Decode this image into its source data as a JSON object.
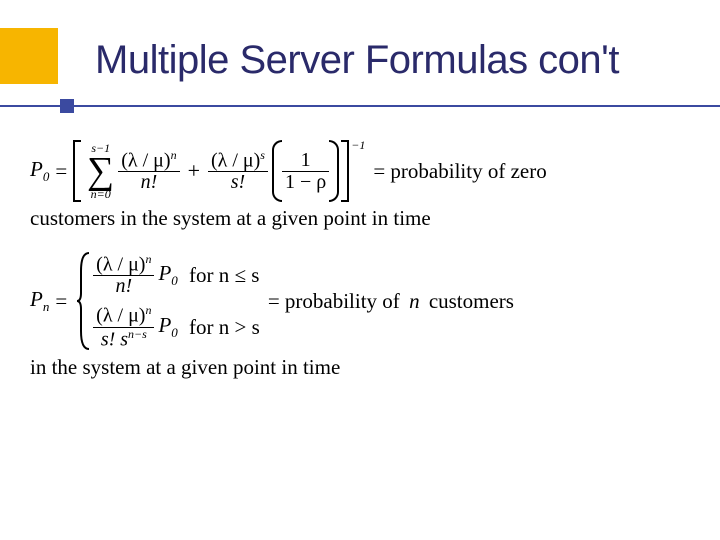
{
  "title": "Multiple Server Formulas con't",
  "eq1": {
    "lhs": "P",
    "lhs_sub": "0",
    "equals": "=",
    "sigma_top": "s−1",
    "sigma_bottom": "n=0",
    "term1_num": "(λ / μ)",
    "term1_num_exp": "n",
    "term1_den": "n!",
    "plus": "+",
    "term2_num": "(λ / μ)",
    "term2_num_exp": "s",
    "term2_den": "s!",
    "term3_num": "1",
    "term3_den": "1 − ρ",
    "outer_exp": "−1",
    "desc1": "= probability of zero",
    "desc2": "customers in the system at a given point in time"
  },
  "eq2": {
    "lhs": "P",
    "lhs_sub": "n",
    "equals": "=",
    "case1_num": "(λ / μ)",
    "case1_num_exp": "n",
    "case1_den": "n!",
    "case1_P": "P",
    "case1_Psub": "0",
    "case1_cond": "for n ≤ s",
    "case2_num": "(λ / μ)",
    "case2_num_exp": "n",
    "case2_den_a": "s! s",
    "case2_den_exp": "n−s",
    "case2_P": "P",
    "case2_Psub": "0",
    "case2_cond": "for n > s",
    "desc1": "= probability of",
    "n_text": "n",
    "desc1b": "customers",
    "desc2": "in the system at a given point in time"
  }
}
